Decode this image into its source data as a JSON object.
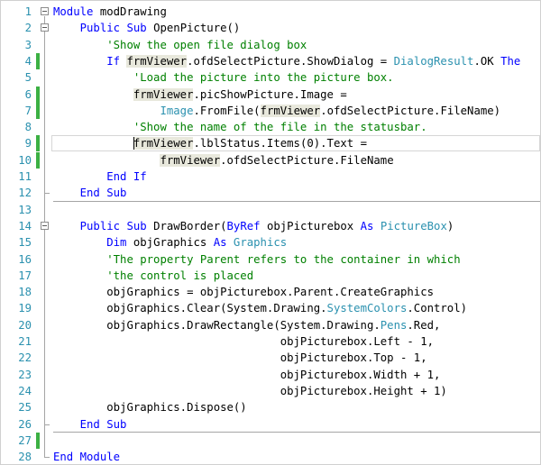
{
  "editor": {
    "colors": {
      "keyword": "#0000ff",
      "type": "#2b91af",
      "comment": "#008000",
      "line_number": "#2b91af",
      "change_saved": "#3cb043",
      "reference_highlight": "#e8e8dc"
    },
    "lines": [
      {
        "num": "1",
        "indent": 0,
        "fold": true,
        "change": false,
        "tokens": [
          {
            "t": "Module",
            "c": "kw"
          },
          {
            "t": " modDrawing",
            "c": ""
          }
        ]
      },
      {
        "num": "2",
        "indent": 4,
        "fold": true,
        "change": false,
        "tokens": [
          {
            "t": "Public",
            "c": "kw"
          },
          {
            "t": " ",
            "c": ""
          },
          {
            "t": "Sub",
            "c": "kw"
          },
          {
            "t": " OpenPicture()",
            "c": ""
          }
        ]
      },
      {
        "num": "3",
        "indent": 8,
        "fold": false,
        "change": false,
        "tokens": [
          {
            "t": "'Show the open file dialog box",
            "c": "cm"
          }
        ]
      },
      {
        "num": "4",
        "indent": 8,
        "fold": false,
        "change": true,
        "tokens": [
          {
            "t": "If",
            "c": "kw"
          },
          {
            "t": " ",
            "c": ""
          },
          {
            "t": "frmViewer",
            "c": "hl"
          },
          {
            "t": ".ofdSelectPicture.ShowDialog = ",
            "c": ""
          },
          {
            "t": "DialogResult",
            "c": "ty"
          },
          {
            "t": ".OK ",
            "c": ""
          },
          {
            "t": "The",
            "c": "kw"
          }
        ]
      },
      {
        "num": "5",
        "indent": 12,
        "fold": false,
        "change": false,
        "tokens": [
          {
            "t": "'Load the picture into the picture box.",
            "c": "cm"
          }
        ]
      },
      {
        "num": "6",
        "indent": 12,
        "fold": false,
        "change": true,
        "tokens": [
          {
            "t": "frmViewer",
            "c": "hl"
          },
          {
            "t": ".picShowPicture.Image =",
            "c": ""
          }
        ]
      },
      {
        "num": "7",
        "indent": 16,
        "fold": false,
        "change": true,
        "tokens": [
          {
            "t": "Image",
            "c": "ty"
          },
          {
            "t": ".FromFile(",
            "c": ""
          },
          {
            "t": "frmViewer",
            "c": "hl"
          },
          {
            "t": ".ofdSelectPicture.FileName)",
            "c": ""
          }
        ]
      },
      {
        "num": "8",
        "indent": 12,
        "fold": false,
        "change": false,
        "tokens": [
          {
            "t": "'Show the name of the file in the statusbar.",
            "c": "cm"
          }
        ]
      },
      {
        "num": "9",
        "indent": 12,
        "fold": false,
        "change": true,
        "current": true,
        "tokens": [
          {
            "t": "frmViewer",
            "c": "hl"
          },
          {
            "t": ".lblStatus.Items(0).Text =",
            "c": ""
          }
        ]
      },
      {
        "num": "10",
        "indent": 16,
        "fold": false,
        "change": true,
        "tokens": [
          {
            "t": "frmViewer",
            "c": "hl"
          },
          {
            "t": ".ofdSelectPicture.FileName",
            "c": ""
          }
        ]
      },
      {
        "num": "11",
        "indent": 8,
        "fold": false,
        "change": false,
        "tokens": [
          {
            "t": "End",
            "c": "kw"
          },
          {
            "t": " ",
            "c": ""
          },
          {
            "t": "If",
            "c": "kw"
          }
        ]
      },
      {
        "num": "12",
        "indent": 4,
        "fold": false,
        "change": false,
        "tokens": [
          {
            "t": "End",
            "c": "kw"
          },
          {
            "t": " ",
            "c": ""
          },
          {
            "t": "Sub",
            "c": "kw"
          }
        ]
      },
      {
        "num": "13",
        "indent": 0,
        "fold": false,
        "change": false,
        "tokens": []
      },
      {
        "num": "14",
        "indent": 4,
        "fold": true,
        "change": false,
        "tokens": [
          {
            "t": "Public",
            "c": "kw"
          },
          {
            "t": " ",
            "c": ""
          },
          {
            "t": "Sub",
            "c": "kw"
          },
          {
            "t": " DrawBorder(",
            "c": ""
          },
          {
            "t": "ByRef",
            "c": "kw"
          },
          {
            "t": " objPicturebox ",
            "c": ""
          },
          {
            "t": "As",
            "c": "kw"
          },
          {
            "t": " ",
            "c": ""
          },
          {
            "t": "PictureBox",
            "c": "ty"
          },
          {
            "t": ")",
            "c": ""
          }
        ]
      },
      {
        "num": "15",
        "indent": 8,
        "fold": false,
        "change": false,
        "tokens": [
          {
            "t": "Dim",
            "c": "kw"
          },
          {
            "t": " objGraphics ",
            "c": ""
          },
          {
            "t": "As",
            "c": "kw"
          },
          {
            "t": " ",
            "c": ""
          },
          {
            "t": "Graphics",
            "c": "ty"
          }
        ]
      },
      {
        "num": "16",
        "indent": 8,
        "fold": false,
        "change": false,
        "tokens": [
          {
            "t": "'The property Parent refers to the container in which",
            "c": "cm"
          }
        ]
      },
      {
        "num": "17",
        "indent": 8,
        "fold": false,
        "change": false,
        "tokens": [
          {
            "t": "'the control is placed",
            "c": "cm"
          }
        ]
      },
      {
        "num": "18",
        "indent": 8,
        "fold": false,
        "change": false,
        "tokens": [
          {
            "t": "objGraphics = objPicturebox.Parent.CreateGraphics",
            "c": ""
          }
        ]
      },
      {
        "num": "19",
        "indent": 8,
        "fold": false,
        "change": false,
        "tokens": [
          {
            "t": "objGraphics.Clear(System.Drawing.",
            "c": ""
          },
          {
            "t": "SystemColors",
            "c": "ty"
          },
          {
            "t": ".Control)",
            "c": ""
          }
        ]
      },
      {
        "num": "20",
        "indent": 8,
        "fold": false,
        "change": false,
        "tokens": [
          {
            "t": "objGraphics.DrawRectangle(System.Drawing.",
            "c": ""
          },
          {
            "t": "Pens",
            "c": "ty"
          },
          {
            "t": ".Red,",
            "c": ""
          }
        ]
      },
      {
        "num": "21",
        "indent": 34,
        "fold": false,
        "change": false,
        "tokens": [
          {
            "t": "objPicturebox.Left - 1,",
            "c": ""
          }
        ]
      },
      {
        "num": "22",
        "indent": 34,
        "fold": false,
        "change": false,
        "tokens": [
          {
            "t": "objPicturebox.Top - 1,",
            "c": ""
          }
        ]
      },
      {
        "num": "23",
        "indent": 34,
        "fold": false,
        "change": false,
        "tokens": [
          {
            "t": "objPicturebox.Width + 1,",
            "c": ""
          }
        ]
      },
      {
        "num": "24",
        "indent": 34,
        "fold": false,
        "change": false,
        "tokens": [
          {
            "t": "objPicturebox.Height + 1)",
            "c": ""
          }
        ]
      },
      {
        "num": "25",
        "indent": 8,
        "fold": false,
        "change": false,
        "tokens": [
          {
            "t": "objGraphics.Dispose()",
            "c": ""
          }
        ]
      },
      {
        "num": "26",
        "indent": 4,
        "fold": false,
        "change": false,
        "tokens": [
          {
            "t": "End",
            "c": "kw"
          },
          {
            "t": " ",
            "c": ""
          },
          {
            "t": "Sub",
            "c": "kw"
          }
        ]
      },
      {
        "num": "27",
        "indent": 0,
        "fold": false,
        "change": true,
        "tokens": []
      },
      {
        "num": "28",
        "indent": 0,
        "fold": false,
        "change": false,
        "tokens": [
          {
            "t": "End",
            "c": "kw"
          },
          {
            "t": " ",
            "c": ""
          },
          {
            "t": "Module",
            "c": "kw"
          }
        ]
      }
    ]
  }
}
